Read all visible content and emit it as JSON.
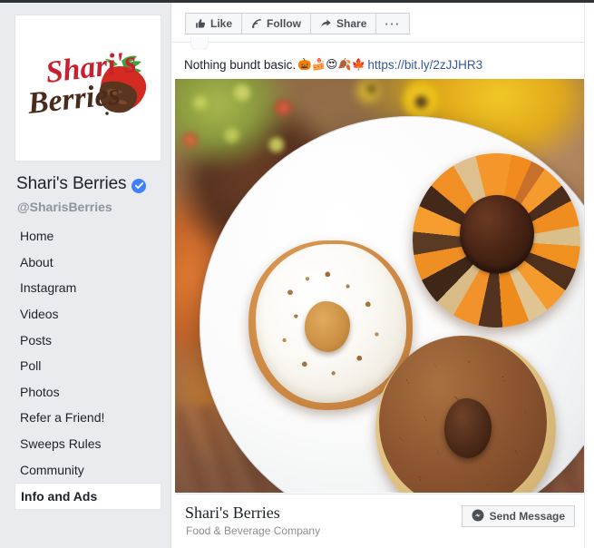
{
  "page": {
    "name": "Shari's Berries",
    "handle": "@SharisBerries",
    "category": "Food & Beverage Company",
    "verified": true,
    "logo": {
      "word_top": "Shari's",
      "word_bottom": "Berries",
      "color_top": "#c8202e",
      "color_bottom": "#4a2a1a",
      "accent_berry_red": "#d32a22",
      "accent_leaf_green": "#3ea33a",
      "accent_chocolate": "#5a3520"
    },
    "accent_color": "#4080ff"
  },
  "sidebar": {
    "items": [
      {
        "label": "Home",
        "active": false
      },
      {
        "label": "About",
        "active": false
      },
      {
        "label": "Instagram",
        "active": false
      },
      {
        "label": "Videos",
        "active": false
      },
      {
        "label": "Posts",
        "active": false
      },
      {
        "label": "Poll",
        "active": false
      },
      {
        "label": "Photos",
        "active": false
      },
      {
        "label": "Refer a Friend!",
        "active": false
      },
      {
        "label": "Sweeps Rules",
        "active": false
      },
      {
        "label": "Community",
        "active": false
      },
      {
        "label": "Info and Ads",
        "active": true
      }
    ]
  },
  "toolbar": {
    "like_label": "Like",
    "like_icon": "thumbs-up-icon",
    "follow_label": "Follow",
    "follow_icon": "rss-follow-icon",
    "share_label": "Share",
    "share_icon": "share-arrow-icon",
    "more_label": "···",
    "more_icon": "ellipsis-icon"
  },
  "post": {
    "text_before": "Nothing bundt basic.",
    "emojis": "🎃🍰😍🍂🍁",
    "emoji_names": [
      "jack-o-lantern",
      "cake-slice",
      "heart-eyes",
      "fallen-leaf",
      "maple-leaf"
    ],
    "link": "https://bit.ly/2zJJHR3",
    "image_alt": "Three autumn bundt cakes on a white plate — white-iced pumpkin pecan, orange-glazed chocolate, and chocolate sprinkle — with apples and sunflowers behind"
  },
  "footer": {
    "page_name": "Shari's Berries",
    "category": "Food & Beverage Company",
    "send_message_label": "Send Message",
    "send_message_icon": "messenger-icon"
  }
}
